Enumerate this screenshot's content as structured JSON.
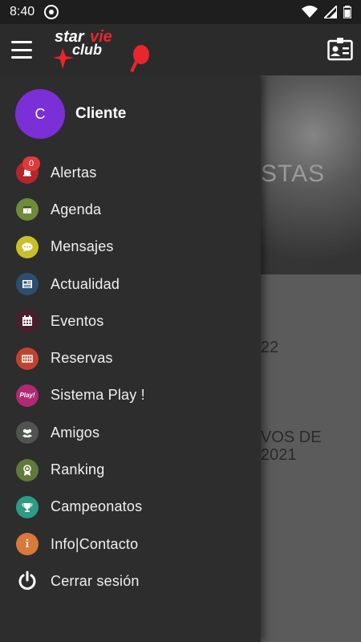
{
  "status_bar": {
    "time": "8:40"
  },
  "app_bar": {
    "logo_text_line1": "starvie",
    "logo_text_line2": "club"
  },
  "background": {
    "hero_title": "STAS",
    "text1": "22",
    "text2_line1": "VOS DE",
    "text2_line2": "2021"
  },
  "drawer": {
    "profile": {
      "avatar_letter": "C",
      "name": "Cliente"
    },
    "items": [
      {
        "label": "Alertas",
        "icon": "bell-icon",
        "color": "#b3262d",
        "badge": "0"
      },
      {
        "label": "Agenda",
        "icon": "calendar-icon",
        "color": "#6f8b3a"
      },
      {
        "label": "Mensajes",
        "icon": "chat-icon",
        "color": "#c8c02a"
      },
      {
        "label": "Actualidad",
        "icon": "newspaper-icon",
        "color": "#2c4f6f"
      },
      {
        "label": "Eventos",
        "icon": "event-calendar-icon",
        "color": "#4a1e2e"
      },
      {
        "label": "Reservas",
        "icon": "court-icon",
        "color": "#c0432f"
      },
      {
        "label": "Sistema Play !",
        "icon": "play-icon",
        "color": "#b02a73",
        "icon_text": "Play!"
      },
      {
        "label": "Amigos",
        "icon": "friends-icon",
        "color": "#4f544f"
      },
      {
        "label": "Ranking",
        "icon": "medal-icon",
        "color": "#5f7a3a"
      },
      {
        "label": "Campeonatos",
        "icon": "trophy-icon",
        "color": "#2f9a86"
      },
      {
        "label": "Info|Contacto",
        "icon": "info-icon",
        "color": "#d9793a",
        "icon_text": "i"
      },
      {
        "label": "Cerrar sesión",
        "icon": "power-icon",
        "color": "#2d2d2d"
      }
    ]
  }
}
